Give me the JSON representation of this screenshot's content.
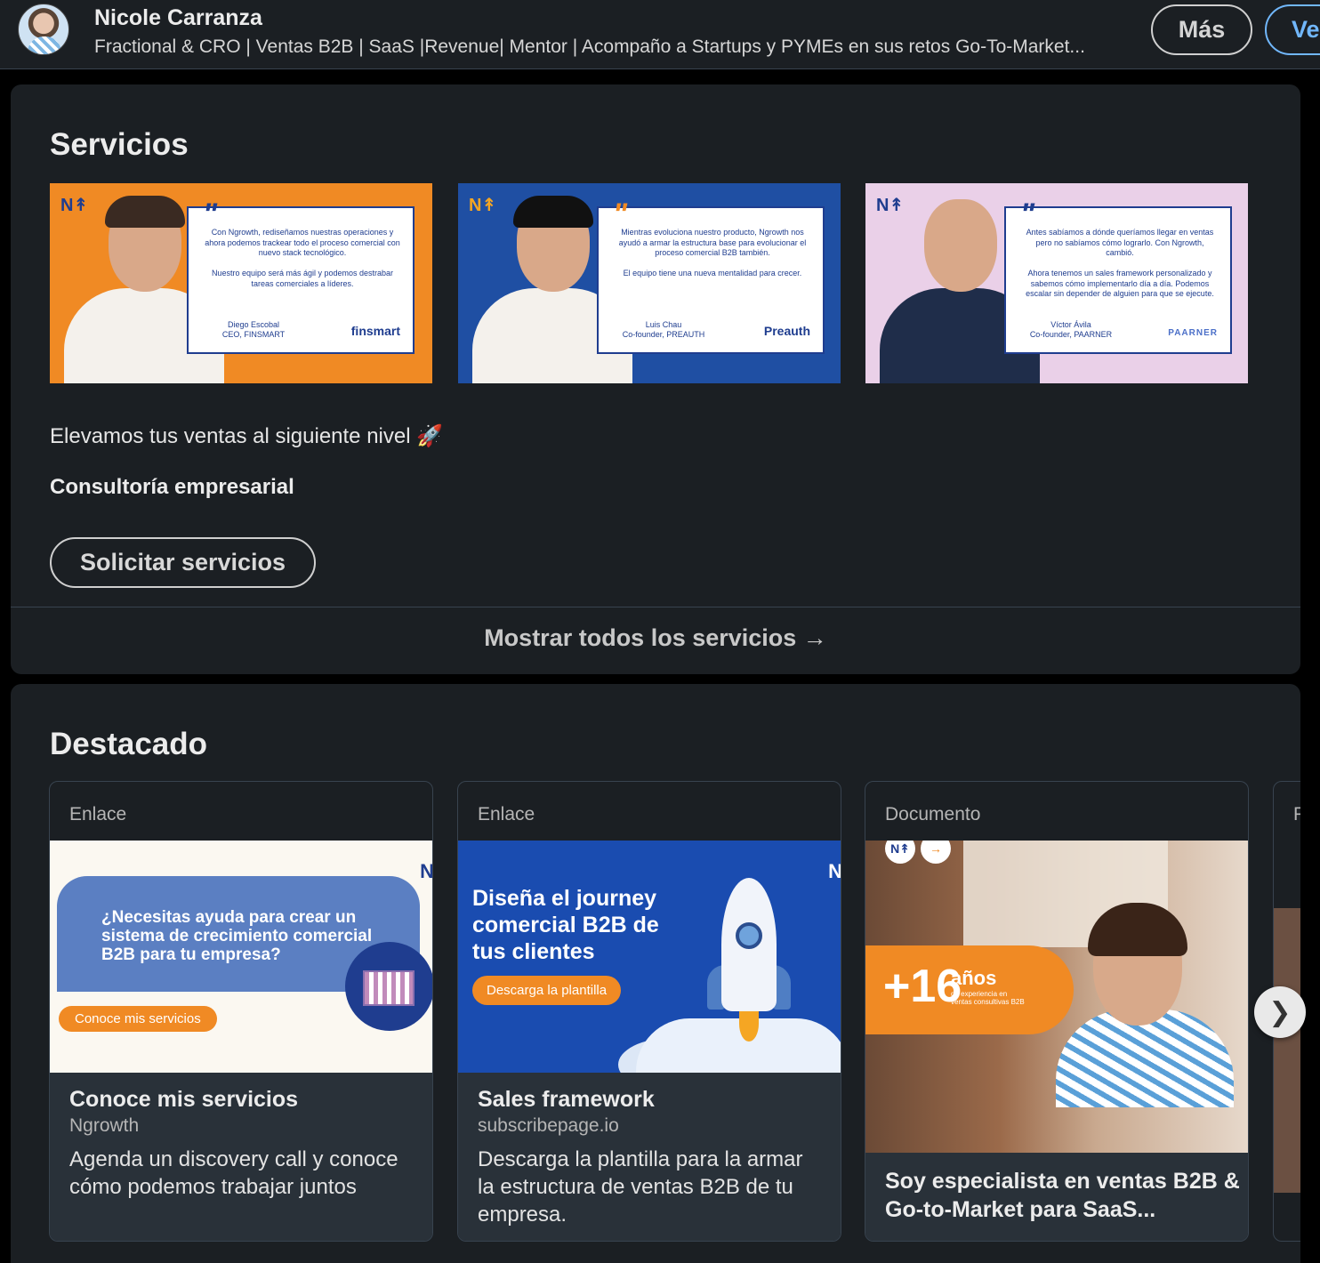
{
  "header": {
    "name": "Nicole Carranza",
    "headline": "Fractional & CRO | Ventas B2B | SaaS |Revenue| Mentor | Acompaño a Startups y PYMEs en sus retos Go-To-Market...",
    "more_label": "Más",
    "view_label": "Ve"
  },
  "services": {
    "title": "Servicios",
    "images": [
      {
        "logo": "N↟",
        "quote_mark": "\"",
        "quote": "Con Ngrowth, rediseñamos nuestras operaciones y ahora podemos trackear todo el proceso comercial con nuevo stack tecnológico.\n\nNuestro equipo será más ágil y podemos destrabar tareas comerciales a líderes.",
        "person": "Diego Escobal\nCEO, FINSMART",
        "brand": "finsmart"
      },
      {
        "logo": "N↟",
        "quote_mark": "\"",
        "quote": "Mientras evoluciona nuestro producto, Ngrowth nos ayudó a armar la estructura base para evolucionar el proceso comercial B2B también.\n\nEl equipo tiene una nueva mentalidad para crecer.",
        "person": "Luis Chau\nCo-founder, PREAUTH",
        "brand": "Preauth"
      },
      {
        "logo": "N↟",
        "quote_mark": "\"",
        "quote": "Antes sabíamos a dónde queríamos llegar en ventas pero no sabíamos cómo lograrlo. Con Ngrowth, cambió.\n\nAhora tenemos un sales framework personalizado y sabemos cómo implementarlo día a día. Podemos escalar sin depender de alguien para que se ejecute.",
        "person": "Víctor Ávila\nCo-founder, PAARNER",
        "brand": "PAARNER"
      }
    ],
    "tagline": "Elevamos tus ventas al siguiente nivel 🚀",
    "subtitle": "Consultoría empresarial",
    "request_button": "Solicitar servicios",
    "show_all": "Mostrar todos los servicios →"
  },
  "featured": {
    "title": "Destacado",
    "items": [
      {
        "type": "Enlace",
        "image_text": "¿Necesitas ayuda para crear un sistema de crecimiento comercial B2B para tu empresa?",
        "image_button": "Conoce mis servicios",
        "image_corner": "N",
        "title": "Conoce mis servicios",
        "source": "Ngrowth",
        "description": "Agenda un discovery call y conoce cómo podemos trabajar juntos"
      },
      {
        "type": "Enlace",
        "image_text": "Diseña el journey comercial B2B de tus clientes",
        "image_button": "Descarga la plantilla",
        "image_corner": "N",
        "title": "Sales framework",
        "source": "subscribepage.io",
        "description": "Descarga la plantilla para la armar la estructura de ventas B2B de tu empresa."
      },
      {
        "type": "Documento",
        "image_badges": [
          "N↟",
          "→"
        ],
        "image_big": "+16",
        "image_years": "años",
        "image_exp": "de experiencia en\nventas consultivas B2B",
        "title": "Soy especialista en ventas B2B & Go-to-Market para SaaS..."
      },
      {
        "type": "P"
      }
    ],
    "next_label": "❯"
  }
}
